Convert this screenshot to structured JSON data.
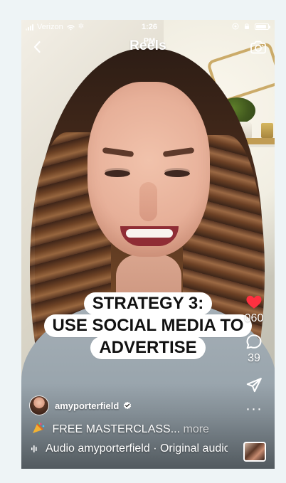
{
  "status_bar": {
    "carrier": "Verizon",
    "time": "1:26 PM"
  },
  "header": {
    "title": "Reels"
  },
  "caption": {
    "lines": [
      "STRATEGY 3:",
      "USE SOCIAL MEDIA TO",
      "ADVERTISE"
    ]
  },
  "actions": {
    "likes_count": "060",
    "comments_count": "39",
    "more_label": "···"
  },
  "creator": {
    "username": "amyporterfield"
  },
  "description": {
    "text": "FREE MASTERCLASS...",
    "more": "more"
  },
  "audio": {
    "text": "Audio  amyporterfield · Original audio"
  },
  "icons": {
    "back": "chevron-left-icon",
    "camera": "camera-icon",
    "heart": "heart-icon",
    "comment": "comment-icon",
    "share": "send-icon",
    "verified": "verified-badge-icon",
    "audio": "audio-wave-icon",
    "party": "party-popper-icon"
  },
  "colors": {
    "accent_like": "#ff3040",
    "text_primary": "#ffffff",
    "caption_bg": "#ffffff",
    "caption_text": "#111111",
    "page_bg": "#eef4f6"
  },
  "system": {
    "battery_fraction": 0.85
  }
}
